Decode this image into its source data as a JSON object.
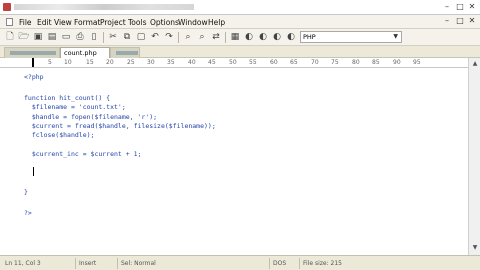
{
  "window": {
    "minimize": "–",
    "maximize": "□",
    "close": "✕"
  },
  "menu": [
    "File",
    "Edit",
    "View",
    "Format",
    "Project",
    "Tools",
    "Options",
    "Window",
    "Help"
  ],
  "toolbar": {
    "syntax": "PHP"
  },
  "tabs": {
    "active": "count.php"
  },
  "ruler": {
    "numbers": [
      "5",
      "10",
      "15",
      "20",
      "25",
      "30",
      "35",
      "40",
      "45",
      "50",
      "55",
      "60",
      "65",
      "70",
      "75",
      "80",
      "85",
      "90",
      "95"
    ]
  },
  "code": {
    "lines": [
      "<?php",
      "",
      "function hit_count() {",
      "  $filename = 'count.txt';",
      "  $handle = fopen($filename, 'r');",
      "  $current = fread($handle, filesize($filename));",
      "  fclose($handle);",
      "",
      "  $current_inc = $current + 1;",
      "",
      "",
      "",
      "}",
      "",
      "?>"
    ]
  },
  "status": {
    "position": "Ln 11, Col 3",
    "mode": "Insert",
    "selection": "Sel: Normal",
    "format": "DOS",
    "filesize": "File size: 215"
  }
}
